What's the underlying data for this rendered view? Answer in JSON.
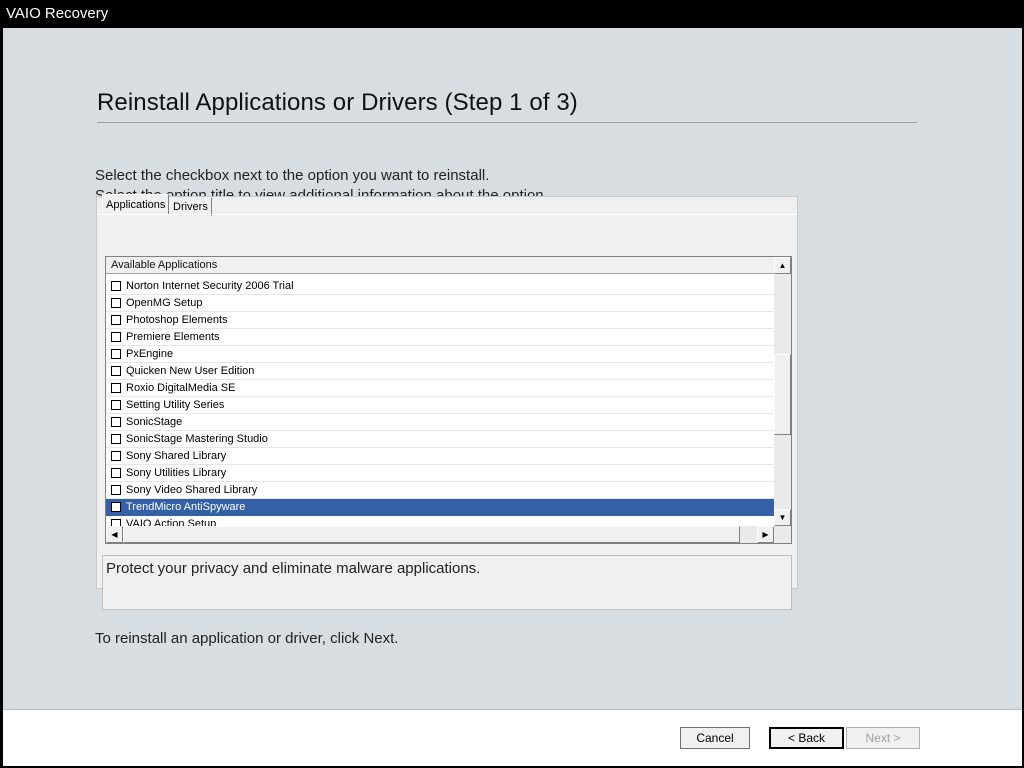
{
  "window": {
    "title": "VAIO Recovery"
  },
  "page": {
    "heading": "Reinstall Applications or Drivers (Step 1 of 3)",
    "instructions": [
      "Select the checkbox next to the option you want to reinstall.",
      "Select the option title to view additional information about the option."
    ],
    "footer_text": "To reinstall an application or driver, click Next."
  },
  "tabs": [
    {
      "label": "Applications",
      "active": true
    },
    {
      "label": "Drivers",
      "active": false
    }
  ],
  "list": {
    "header": "Available Applications",
    "items": [
      {
        "label": "Norton Internet Security 2006 Trial",
        "checked": false,
        "selected": false
      },
      {
        "label": "OpenMG Setup",
        "checked": false,
        "selected": false
      },
      {
        "label": "Photoshop Elements",
        "checked": false,
        "selected": false
      },
      {
        "label": "Premiere Elements",
        "checked": false,
        "selected": false
      },
      {
        "label": "PxEngine",
        "checked": false,
        "selected": false
      },
      {
        "label": "Quicken New User Edition",
        "checked": false,
        "selected": false
      },
      {
        "label": "Roxio DigitalMedia SE",
        "checked": false,
        "selected": false
      },
      {
        "label": "Setting Utility Series",
        "checked": false,
        "selected": false
      },
      {
        "label": "SonicStage",
        "checked": false,
        "selected": false
      },
      {
        "label": "SonicStage Mastering Studio",
        "checked": false,
        "selected": false
      },
      {
        "label": "Sony Shared Library",
        "checked": false,
        "selected": false
      },
      {
        "label": "Sony Utilities Library",
        "checked": false,
        "selected": false
      },
      {
        "label": "Sony Video Shared Library",
        "checked": false,
        "selected": false
      },
      {
        "label": "TrendMicro AntiSpyware",
        "checked": false,
        "selected": true
      },
      {
        "label": "VAIO Action Setup",
        "checked": false,
        "selected": false
      }
    ]
  },
  "description": "Protect your privacy and eliminate malware applications.",
  "buttons": {
    "cancel": "Cancel",
    "back": "< Back",
    "next": "Next >"
  },
  "colors": {
    "selection": "#3460a8",
    "background": "#d7dde1"
  }
}
